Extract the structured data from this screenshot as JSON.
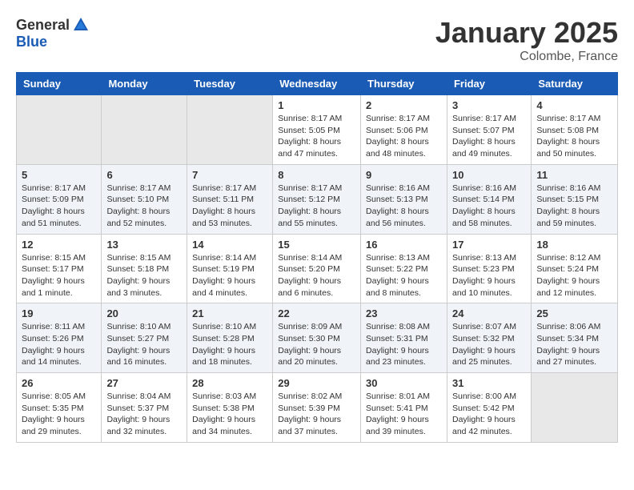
{
  "header": {
    "logo_general": "General",
    "logo_blue": "Blue",
    "title": "January 2025",
    "location": "Colombe, France"
  },
  "days_of_week": [
    "Sunday",
    "Monday",
    "Tuesday",
    "Wednesday",
    "Thursday",
    "Friday",
    "Saturday"
  ],
  "weeks": [
    [
      {
        "day": "",
        "empty": true
      },
      {
        "day": "",
        "empty": true
      },
      {
        "day": "",
        "empty": true
      },
      {
        "day": "1",
        "sunrise": "8:17 AM",
        "sunset": "5:05 PM",
        "daylight": "8 hours and 47 minutes."
      },
      {
        "day": "2",
        "sunrise": "8:17 AM",
        "sunset": "5:06 PM",
        "daylight": "8 hours and 48 minutes."
      },
      {
        "day": "3",
        "sunrise": "8:17 AM",
        "sunset": "5:07 PM",
        "daylight": "8 hours and 49 minutes."
      },
      {
        "day": "4",
        "sunrise": "8:17 AM",
        "sunset": "5:08 PM",
        "daylight": "8 hours and 50 minutes."
      }
    ],
    [
      {
        "day": "5",
        "sunrise": "8:17 AM",
        "sunset": "5:09 PM",
        "daylight": "8 hours and 51 minutes."
      },
      {
        "day": "6",
        "sunrise": "8:17 AM",
        "sunset": "5:10 PM",
        "daylight": "8 hours and 52 minutes."
      },
      {
        "day": "7",
        "sunrise": "8:17 AM",
        "sunset": "5:11 PM",
        "daylight": "8 hours and 53 minutes."
      },
      {
        "day": "8",
        "sunrise": "8:17 AM",
        "sunset": "5:12 PM",
        "daylight": "8 hours and 55 minutes."
      },
      {
        "day": "9",
        "sunrise": "8:16 AM",
        "sunset": "5:13 PM",
        "daylight": "8 hours and 56 minutes."
      },
      {
        "day": "10",
        "sunrise": "8:16 AM",
        "sunset": "5:14 PM",
        "daylight": "8 hours and 58 minutes."
      },
      {
        "day": "11",
        "sunrise": "8:16 AM",
        "sunset": "5:15 PM",
        "daylight": "8 hours and 59 minutes."
      }
    ],
    [
      {
        "day": "12",
        "sunrise": "8:15 AM",
        "sunset": "5:17 PM",
        "daylight": "9 hours and 1 minute."
      },
      {
        "day": "13",
        "sunrise": "8:15 AM",
        "sunset": "5:18 PM",
        "daylight": "9 hours and 3 minutes."
      },
      {
        "day": "14",
        "sunrise": "8:14 AM",
        "sunset": "5:19 PM",
        "daylight": "9 hours and 4 minutes."
      },
      {
        "day": "15",
        "sunrise": "8:14 AM",
        "sunset": "5:20 PM",
        "daylight": "9 hours and 6 minutes."
      },
      {
        "day": "16",
        "sunrise": "8:13 AM",
        "sunset": "5:22 PM",
        "daylight": "9 hours and 8 minutes."
      },
      {
        "day": "17",
        "sunrise": "8:13 AM",
        "sunset": "5:23 PM",
        "daylight": "9 hours and 10 minutes."
      },
      {
        "day": "18",
        "sunrise": "8:12 AM",
        "sunset": "5:24 PM",
        "daylight": "9 hours and 12 minutes."
      }
    ],
    [
      {
        "day": "19",
        "sunrise": "8:11 AM",
        "sunset": "5:26 PM",
        "daylight": "9 hours and 14 minutes."
      },
      {
        "day": "20",
        "sunrise": "8:10 AM",
        "sunset": "5:27 PM",
        "daylight": "9 hours and 16 minutes."
      },
      {
        "day": "21",
        "sunrise": "8:10 AM",
        "sunset": "5:28 PM",
        "daylight": "9 hours and 18 minutes."
      },
      {
        "day": "22",
        "sunrise": "8:09 AM",
        "sunset": "5:30 PM",
        "daylight": "9 hours and 20 minutes."
      },
      {
        "day": "23",
        "sunrise": "8:08 AM",
        "sunset": "5:31 PM",
        "daylight": "9 hours and 23 minutes."
      },
      {
        "day": "24",
        "sunrise": "8:07 AM",
        "sunset": "5:32 PM",
        "daylight": "9 hours and 25 minutes."
      },
      {
        "day": "25",
        "sunrise": "8:06 AM",
        "sunset": "5:34 PM",
        "daylight": "9 hours and 27 minutes."
      }
    ],
    [
      {
        "day": "26",
        "sunrise": "8:05 AM",
        "sunset": "5:35 PM",
        "daylight": "9 hours and 29 minutes."
      },
      {
        "day": "27",
        "sunrise": "8:04 AM",
        "sunset": "5:37 PM",
        "daylight": "9 hours and 32 minutes."
      },
      {
        "day": "28",
        "sunrise": "8:03 AM",
        "sunset": "5:38 PM",
        "daylight": "9 hours and 34 minutes."
      },
      {
        "day": "29",
        "sunrise": "8:02 AM",
        "sunset": "5:39 PM",
        "daylight": "9 hours and 37 minutes."
      },
      {
        "day": "30",
        "sunrise": "8:01 AM",
        "sunset": "5:41 PM",
        "daylight": "9 hours and 39 minutes."
      },
      {
        "day": "31",
        "sunrise": "8:00 AM",
        "sunset": "5:42 PM",
        "daylight": "9 hours and 42 minutes."
      },
      {
        "day": "",
        "empty": true
      }
    ]
  ]
}
